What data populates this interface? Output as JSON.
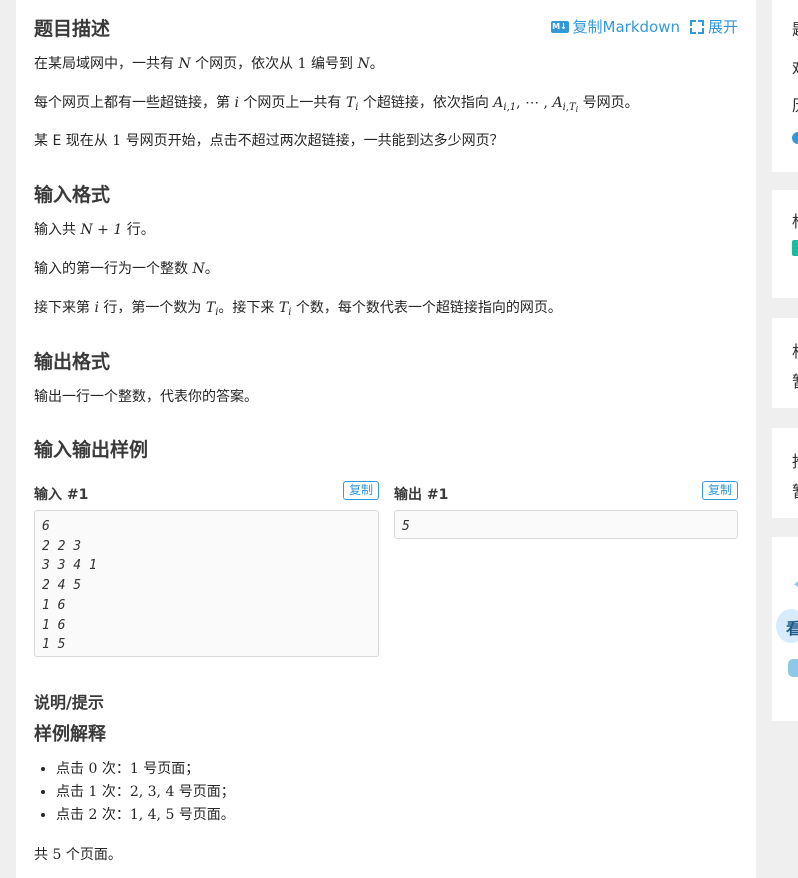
{
  "header": {
    "title": "题目描述",
    "copy_markdown_icon": "M↓",
    "copy_markdown_label": "复制Markdown",
    "expand_label": "展开"
  },
  "description": {
    "p1_a": "在某局域网中，一共有 ",
    "p1_var": "N",
    "p1_b": " 个网页，依次从 ",
    "p1_num": "1",
    "p1_c": " 编号到 ",
    "p1_var2": "N",
    "p1_d": "。",
    "p2_a": "每个网页上都有一些超链接，第 ",
    "p2_var": "i",
    "p2_b": " 个网页上一共有 ",
    "p2_T": "T",
    "p2_Tsub": "i",
    "p2_c": " 个超链接，依次指向 ",
    "p2_A1": "A",
    "p2_A1sub": "i,1",
    "p2_dots": ", ⋯ , ",
    "p2_A2": "A",
    "p2_A2sub": "i,T",
    "p2_A2subsub": "i",
    "p2_d": " 号网页。",
    "p3_a": "某 E 现在从 ",
    "p3_num": "1",
    "p3_b": " 号网页开始，点击不超过两次超链接，一共能到达多少网页？"
  },
  "input_format": {
    "title": "输入格式",
    "p1_a": "输入共 ",
    "p1_math": "N + 1",
    "p1_b": " 行。",
    "p2_a": "输入的第一行为一个整数 ",
    "p2_var": "N",
    "p2_b": "。",
    "p3_a": "接下来第 ",
    "p3_var": "i",
    "p3_b": " 行，第一个数为 ",
    "p3_T": "T",
    "p3_Tsub": "i",
    "p3_c": "。接下来 ",
    "p3_T2": "T",
    "p3_T2sub": "i",
    "p3_d": " 个数，每个数代表一个超链接指向的网页。"
  },
  "output_format": {
    "title": "输出格式",
    "p1": "输出一行一个整数，代表你的答案。"
  },
  "samples": {
    "title": "输入输出样例",
    "input_label": "输入 #1",
    "output_label": "输出 #1",
    "copy_label": "复制",
    "input_text": "6\n2 2 3\n3 3 4 1\n2 4 5\n1 6\n1 6\n1 5",
    "output_text": "5"
  },
  "hint": {
    "title": "说明/提示",
    "subtitle": "样例解释",
    "items": [
      {
        "a": "点击 ",
        "n": "0",
        "b": " 次：",
        "v": "1",
        "c": " 号页面；"
      },
      {
        "a": "点击 ",
        "n": "1",
        "b": " 次：",
        "v": "2, 3, 4",
        "c": " 号页面；"
      },
      {
        "a": "点击 ",
        "n": "2",
        "b": " 次：",
        "v": "1, 4, 5",
        "c": " 号页面。"
      }
    ],
    "total_a": "共 ",
    "total_n": "5",
    "total_b": " 个页面。"
  },
  "sidebar": {
    "c1_l1": "题",
    "c1_l2": "难",
    "c1_l3": "历",
    "c2_l1": "标",
    "c3_l1": "相",
    "c3_l2": "暂",
    "c4_l1": "推",
    "c4_l2": "暂",
    "c5_l1": "看"
  },
  "colors": {
    "accent": "#3498db",
    "tag": "#1abc9c"
  }
}
